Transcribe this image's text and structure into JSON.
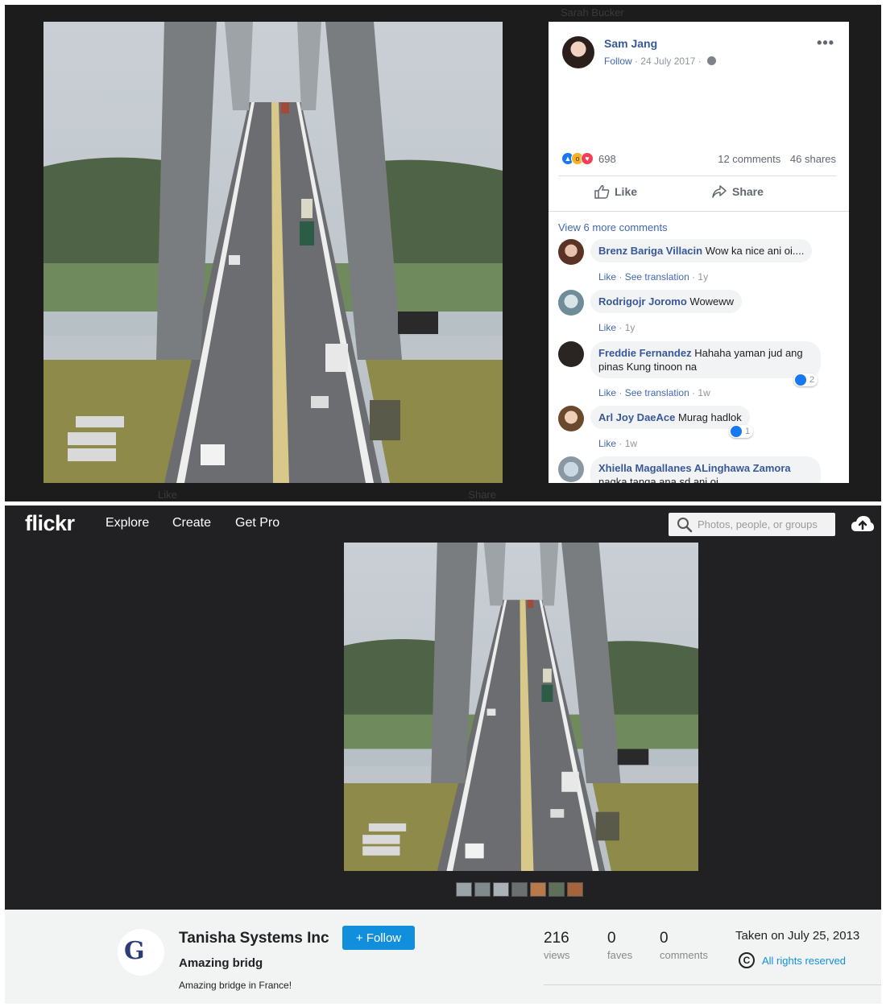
{
  "facebook": {
    "ghost_name": "Sarah Bucker",
    "ghost_bar": [
      "Like",
      "Share"
    ],
    "post": {
      "author": "Sam Jang",
      "follow": "Follow",
      "date": "24 July 2017",
      "reaction_count": "698",
      "comments": "12 comments",
      "shares": "46 shares",
      "like_label": "Like",
      "share_label": "Share"
    },
    "view_more": "View 6 more comments",
    "comments": [
      {
        "name": "Brenz Bariga Villacin",
        "text": "Wow ka nice ani oi....",
        "actions": [
          "Like",
          "See translation"
        ],
        "age": "1y"
      },
      {
        "name": "Rodrigojr Joromo",
        "text": "Woweww",
        "actions": [
          "Like"
        ],
        "age": "1y"
      },
      {
        "name": "Freddie Fernandez",
        "text": "Hahaha yaman jud ang pinas Kung tinoon na",
        "actions": [
          "Like",
          "See translation"
        ],
        "age": "1w",
        "reactions": "2"
      },
      {
        "name": "Arl Joy DaeAce",
        "text": "Murag hadlok",
        "actions": [
          "Like"
        ],
        "age": "1w",
        "reactions": "1"
      },
      {
        "name": "Xhiella Magallanes ALinghawa Zamora",
        "text": "nagka tanga ana sd ani oi",
        "actions": [],
        "age": ""
      }
    ]
  },
  "flickr": {
    "logo": "flickr",
    "nav": {
      "explore": "Explore",
      "create": "Create",
      "getpro": "Get Pro"
    },
    "search_placeholder": "Photos, people, or groups",
    "owner": "Tanisha Systems Inc",
    "follow_label": "+ Follow",
    "photo_title": "Amazing bridg",
    "description": "Amazing bridge in France!",
    "stats": {
      "views": {
        "value": "216",
        "label": "views"
      },
      "faves": {
        "value": "0",
        "label": "faves"
      },
      "comments": {
        "value": "0",
        "label": "comments"
      }
    },
    "taken": "Taken on July 25, 2013",
    "rights": "All rights reserved",
    "avatar_monogram": "G"
  },
  "colors": {
    "fb_link": "#385898",
    "fb_blue": "#4267b2",
    "flickr_blue": "#128fdc",
    "flickr_dark": "#212124"
  }
}
